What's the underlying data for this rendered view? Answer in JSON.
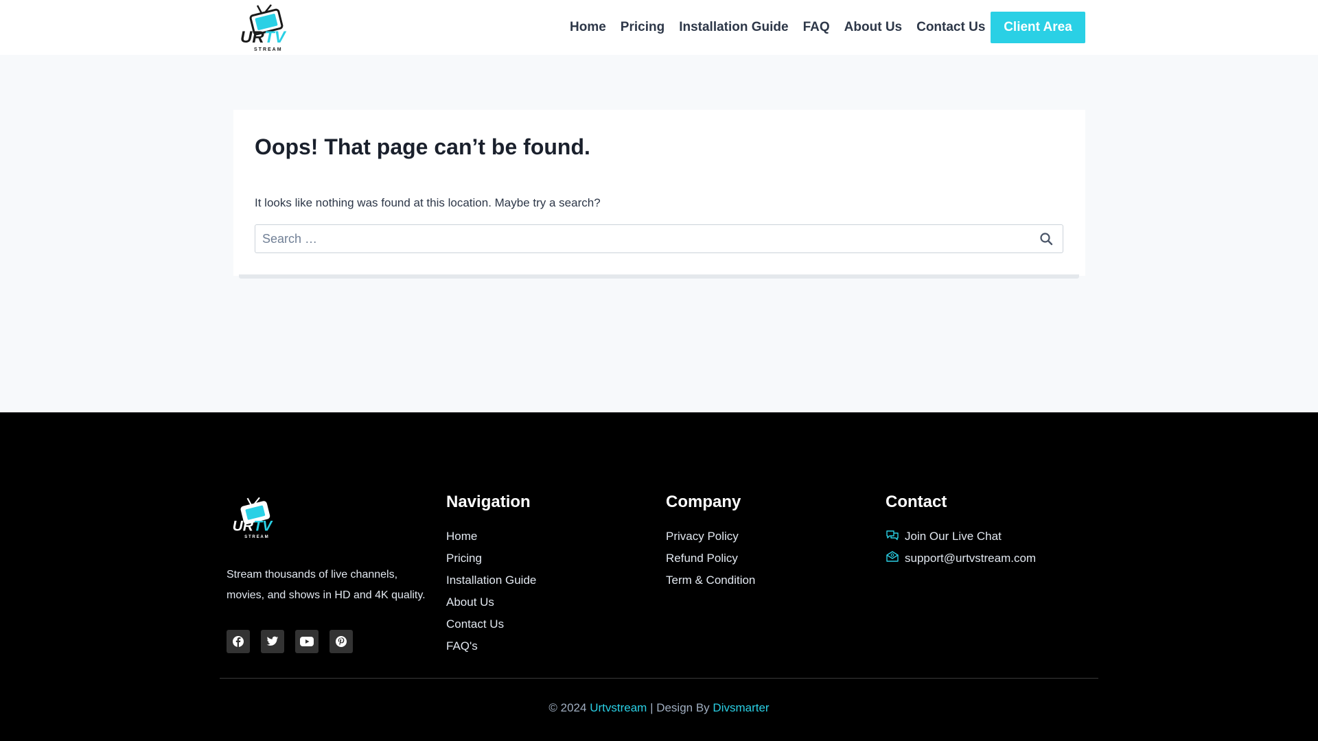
{
  "colors": {
    "accent": "#2ad0e5",
    "footer_bg": "#000000",
    "page_bg": "#f7f9fb"
  },
  "header": {
    "logo_alt": "URTV STREAM",
    "nav": [
      "Home",
      "Pricing",
      "Installation Guide",
      "FAQ",
      "About Us",
      "Contact Us"
    ],
    "cta_label": "Client Area"
  },
  "main": {
    "title": "Oops! That page can’t be found.",
    "message": "It looks like nothing was found at this location. Maybe try a search?",
    "search": {
      "placeholder": "Search …",
      "value": "",
      "button_icon": "search-icon"
    }
  },
  "footer": {
    "logo_alt": "URTV STREAM",
    "description": "Stream thousands of live channels, movies, and shows in HD and 4K quality.",
    "socials": [
      "facebook-icon",
      "twitter-icon",
      "youtube-icon",
      "pinterest-icon"
    ],
    "navigation": {
      "heading": "Navigation",
      "items": [
        "Home",
        "Pricing",
        "Installation Guide",
        "About Us",
        "Contact Us",
        "FAQ's"
      ]
    },
    "company": {
      "heading": "Company",
      "items": [
        "Privacy Policy",
        "Refund Policy",
        "Term & Condition"
      ]
    },
    "contact": {
      "heading": "Contact",
      "live_chat": "Join Our Live Chat",
      "email": "support@urtvstream.com"
    },
    "copyright": {
      "prefix": "© 2024",
      "brand": "Urtvstream",
      "middle": "| Design By",
      "designer": "Divsmarter"
    }
  }
}
